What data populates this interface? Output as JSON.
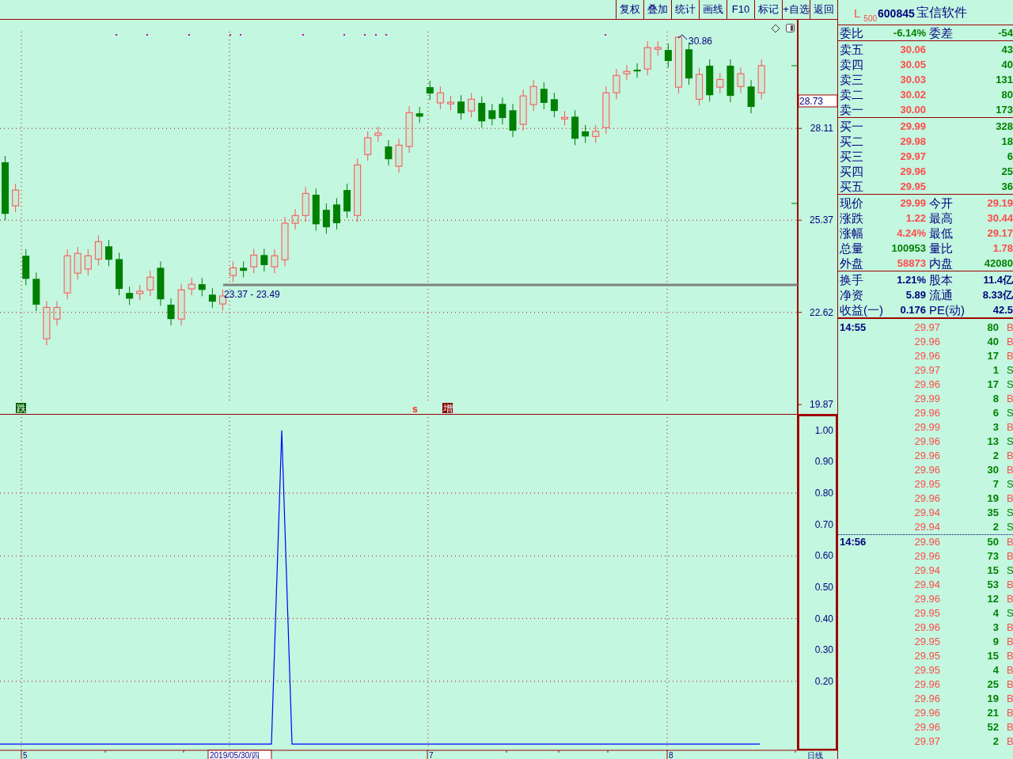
{
  "toolbar": [
    {
      "label": "复权"
    },
    {
      "label": "叠加"
    },
    {
      "label": "统计"
    },
    {
      "label": "画线"
    },
    {
      "label": "F10"
    },
    {
      "label": "标记"
    },
    {
      "label": "+自选"
    },
    {
      "label": "返回"
    }
  ],
  "quote_header": {
    "market": "L",
    "board": "500",
    "code": "600845",
    "name": "宝信软件"
  },
  "order_ratio": {
    "label": "委比",
    "value": "-6.14%",
    "label2": "委差",
    "value2": "-54"
  },
  "asks": [
    {
      "label": "卖五",
      "price": "30.06",
      "volume": "43"
    },
    {
      "label": "卖四",
      "price": "30.05",
      "volume": "40"
    },
    {
      "label": "卖三",
      "price": "30.03",
      "volume": "131"
    },
    {
      "label": "卖二",
      "price": "30.02",
      "volume": "80"
    },
    {
      "label": "卖一",
      "price": "30.00",
      "volume": "173"
    }
  ],
  "bids": [
    {
      "label": "买一",
      "price": "29.99",
      "volume": "328"
    },
    {
      "label": "买二",
      "price": "29.98",
      "volume": "18"
    },
    {
      "label": "买三",
      "price": "29.97",
      "volume": "6"
    },
    {
      "label": "买四",
      "price": "29.96",
      "volume": "25"
    },
    {
      "label": "买五",
      "price": "29.95",
      "volume": "36"
    }
  ],
  "stats": [
    {
      "left": {
        "label": "现价",
        "value": "29.99",
        "color": "#ff4a4a"
      },
      "right": {
        "label": "今开",
        "value": "29.19",
        "color": "#ff4a4a"
      }
    },
    {
      "left": {
        "label": "涨跌",
        "value": "1.22",
        "color": "#ff4a4a"
      },
      "right": {
        "label": "最高",
        "value": "30.44",
        "color": "#ff4a4a"
      }
    },
    {
      "left": {
        "label": "涨幅",
        "value": "4.24%",
        "color": "#ff4a4a"
      },
      "right": {
        "label": "最低",
        "value": "29.17",
        "color": "#ff4a4a"
      }
    },
    {
      "left": {
        "label": "总量",
        "value": "100953",
        "color": "#008000"
      },
      "right": {
        "label": "量比",
        "value": "1.78",
        "color": "#ff4a4a"
      }
    },
    {
      "left": {
        "label": "外盘",
        "value": "58873",
        "color": "#ff4a4a"
      },
      "right": {
        "label": "内盘",
        "value": "42080",
        "color": "#008000"
      }
    }
  ],
  "fundamentals": [
    {
      "label": "换手",
      "value": "1.21%",
      "label2": "股本",
      "value2": "11.4亿"
    },
    {
      "label": "净资",
      "value": "5.89",
      "label2": "流通",
      "value2": "8.33亿"
    },
    {
      "label": "收益(一)",
      "value": "0.176",
      "label2": "PE(动)",
      "value2": "42.5"
    }
  ],
  "trade_groups": [
    {
      "time": "14:55",
      "trades": [
        {
          "price": "29.97",
          "volume": "80",
          "side": "B",
          "kind": "buy"
        },
        {
          "price": "29.96",
          "volume": "40",
          "side": "B",
          "kind": "buy"
        },
        {
          "price": "29.96",
          "volume": "17",
          "side": "B",
          "kind": "buy"
        },
        {
          "price": "29.97",
          "volume": "1",
          "side": "S",
          "kind": "sell"
        },
        {
          "price": "29.96",
          "volume": "17",
          "side": "S",
          "kind": "sell"
        },
        {
          "price": "29.99",
          "volume": "8",
          "side": "B",
          "kind": "buy"
        },
        {
          "price": "29.96",
          "volume": "6",
          "side": "S",
          "kind": "sell"
        },
        {
          "price": "29.99",
          "volume": "3",
          "side": "B",
          "kind": "buy"
        },
        {
          "price": "29.96",
          "volume": "13",
          "side": "S",
          "kind": "sell"
        },
        {
          "price": "29.96",
          "volume": "2",
          "side": "B",
          "kind": "buy"
        },
        {
          "price": "29.96",
          "volume": "30",
          "side": "B",
          "kind": "buy"
        },
        {
          "price": "29.95",
          "volume": "7",
          "side": "S",
          "kind": "sell"
        },
        {
          "price": "29.96",
          "volume": "19",
          "side": "B",
          "kind": "buy"
        },
        {
          "price": "29.94",
          "volume": "35",
          "side": "S",
          "kind": "sell"
        },
        {
          "price": "29.94",
          "volume": "2",
          "side": "S",
          "kind": "sell"
        }
      ]
    },
    {
      "time": "14:56",
      "trades": [
        {
          "price": "29.96",
          "volume": "50",
          "side": "B",
          "kind": "buy"
        },
        {
          "price": "29.96",
          "volume": "73",
          "side": "B",
          "kind": "buy"
        },
        {
          "price": "29.94",
          "volume": "15",
          "side": "S",
          "kind": "sell"
        },
        {
          "price": "29.94",
          "volume": "53",
          "side": "B",
          "kind": "buy"
        },
        {
          "price": "29.96",
          "volume": "12",
          "side": "B",
          "kind": "buy"
        },
        {
          "price": "29.95",
          "volume": "4",
          "side": "S",
          "kind": "sell"
        },
        {
          "price": "29.96",
          "volume": "3",
          "side": "B",
          "kind": "buy"
        },
        {
          "price": "29.95",
          "volume": "9",
          "side": "B",
          "kind": "buy"
        },
        {
          "price": "29.95",
          "volume": "15",
          "side": "B",
          "kind": "buy"
        },
        {
          "price": "29.95",
          "volume": "4",
          "side": "B",
          "kind": "buy"
        },
        {
          "price": "29.96",
          "volume": "25",
          "side": "B",
          "kind": "buy"
        },
        {
          "price": "29.96",
          "volume": "19",
          "side": "B",
          "kind": "buy"
        },
        {
          "price": "29.96",
          "volume": "21",
          "side": "B",
          "kind": "buy"
        },
        {
          "price": "29.96",
          "volume": "52",
          "side": "B",
          "kind": "buy"
        },
        {
          "price": "29.97",
          "volume": "2",
          "side": "B",
          "kind": "buy"
        }
      ]
    }
  ],
  "price_axis": {
    "current_label": "28.73"
  },
  "price_chart": {
    "high_label": "30.86",
    "range_label": "23.37 - 23.49",
    "markers": [
      {
        "text": "跌",
        "kind": "badge_down"
      },
      {
        "text": "s",
        "kind": "letter"
      },
      {
        "text": "增",
        "kind": "badge_up"
      }
    ],
    "chart_data": {
      "type": "candlestick",
      "grid": true,
      "ylim": [
        19.59,
        31.35
      ],
      "yticks": [
        28.11,
        25.37,
        22.62,
        19.87
      ],
      "categories": [
        null,
        null,
        null,
        null,
        null,
        null,
        null,
        null,
        null,
        null,
        null,
        null,
        null,
        null,
        null,
        null,
        null,
        null,
        null,
        null,
        null,
        null,
        null,
        null,
        null,
        null,
        null,
        null,
        null,
        null,
        null,
        null,
        null,
        null,
        null,
        null,
        null,
        null,
        null,
        null,
        null,
        null,
        null,
        null,
        null,
        null,
        null,
        null,
        null,
        null,
        null,
        null,
        null,
        null,
        null,
        null,
        null,
        null,
        null,
        null,
        null,
        null,
        null,
        null,
        null,
        null,
        null,
        null,
        null,
        null,
        null,
        null,
        null,
        null,
        null,
        null,
        null
      ],
      "ohlc": [
        [
          27.1,
          27.29,
          25.37,
          25.56
        ],
        [
          25.8,
          26.46,
          25.61,
          26.27
        ],
        [
          24.31,
          24.5,
          23.43,
          23.62
        ],
        [
          23.62,
          23.81,
          22.66,
          22.85
        ],
        [
          21.83,
          22.96,
          21.64,
          22.77
        ],
        [
          22.42,
          22.96,
          22.23,
          22.77
        ],
        [
          23.2,
          24.5,
          23.01,
          24.31
        ],
        [
          23.79,
          24.57,
          23.6,
          24.38
        ],
        [
          23.91,
          24.5,
          23.72,
          24.31
        ],
        [
          24.21,
          24.92,
          24.02,
          24.73
        ],
        [
          24.59,
          24.78,
          24.0,
          24.19
        ],
        [
          24.21,
          24.4,
          23.13,
          23.32
        ],
        [
          23.2,
          23.39,
          22.84,
          23.03
        ],
        [
          23.18,
          23.44,
          22.99,
          23.25
        ],
        [
          23.29,
          23.86,
          23.1,
          23.67
        ],
        [
          23.95,
          24.14,
          22.82,
          23.01
        ],
        [
          22.85,
          23.04,
          22.23,
          22.42
        ],
        [
          22.42,
          23.48,
          22.23,
          23.29
        ],
        [
          23.32,
          23.65,
          23.13,
          23.46
        ],
        [
          23.46,
          23.65,
          23.1,
          23.29
        ],
        [
          23.15,
          23.34,
          22.75,
          22.94
        ],
        [
          22.87,
          23.3,
          22.68,
          23.11
        ],
        [
          23.72,
          24.14,
          23.53,
          23.95
        ],
        [
          23.95,
          24.14,
          23.67,
          23.86
        ],
        [
          23.98,
          24.52,
          23.79,
          24.33
        ],
        [
          24.33,
          24.52,
          23.84,
          24.03
        ],
        [
          23.98,
          24.5,
          23.79,
          24.31
        ],
        [
          24.19,
          25.47,
          24.0,
          25.28
        ],
        [
          25.28,
          25.7,
          25.09,
          25.51
        ],
        [
          25.51,
          26.36,
          25.32,
          26.17
        ],
        [
          26.13,
          26.32,
          25.06,
          25.25
        ],
        [
          25.68,
          25.87,
          24.97,
          25.16
        ],
        [
          25.84,
          26.03,
          25.09,
          25.28
        ],
        [
          26.27,
          26.46,
          25.44,
          25.63
        ],
        [
          25.51,
          27.21,
          25.32,
          27.02
        ],
        [
          27.33,
          28.02,
          27.14,
          27.83
        ],
        [
          27.9,
          28.16,
          27.71,
          27.97
        ],
        [
          27.57,
          27.76,
          27.0,
          27.19
        ],
        [
          26.98,
          27.8,
          26.79,
          27.61
        ],
        [
          27.57,
          28.77,
          27.38,
          28.58
        ],
        [
          28.56,
          28.75,
          28.27,
          28.46
        ],
        [
          29.34,
          29.53,
          28.96,
          29.15
        ],
        [
          28.87,
          29.36,
          28.68,
          29.17
        ],
        [
          28.84,
          29.08,
          28.65,
          28.89
        ],
        [
          28.91,
          29.1,
          28.37,
          28.56
        ],
        [
          28.63,
          29.17,
          28.44,
          28.98
        ],
        [
          28.87,
          29.06,
          28.13,
          28.32
        ],
        [
          28.65,
          28.84,
          28.2,
          28.39
        ],
        [
          28.84,
          29.03,
          28.23,
          28.42
        ],
        [
          28.65,
          28.84,
          27.85,
          28.04
        ],
        [
          28.23,
          29.27,
          28.04,
          29.08
        ],
        [
          28.82,
          29.55,
          28.63,
          29.36
        ],
        [
          29.29,
          29.48,
          28.68,
          28.87
        ],
        [
          28.98,
          29.17,
          28.44,
          28.63
        ],
        [
          28.39,
          28.63,
          28.2,
          28.44
        ],
        [
          28.46,
          28.65,
          27.61,
          27.8
        ],
        [
          28.02,
          28.21,
          27.68,
          27.87
        ],
        [
          27.87,
          28.21,
          27.68,
          28.02
        ],
        [
          28.13,
          29.36,
          27.94,
          29.17
        ],
        [
          29.17,
          29.88,
          28.98,
          29.69
        ],
        [
          29.74,
          30.0,
          29.55,
          29.81
        ],
        [
          29.86,
          30.05,
          29.62,
          29.81
        ],
        [
          29.88,
          30.71,
          29.69,
          30.52
        ],
        [
          30.47,
          30.71,
          30.28,
          30.52
        ],
        [
          30.45,
          30.64,
          29.93,
          30.12
        ],
        [
          29.34,
          30.86,
          29.15,
          30.83
        ],
        [
          30.47,
          30.66,
          29.41,
          29.6
        ],
        [
          28.98,
          29.91,
          28.79,
          29.72
        ],
        [
          29.98,
          30.17,
          28.91,
          29.1
        ],
        [
          29.34,
          29.76,
          29.15,
          29.57
        ],
        [
          29.98,
          30.17,
          28.89,
          29.08
        ],
        [
          29.36,
          29.93,
          29.17,
          29.74
        ],
        [
          29.36,
          29.55,
          28.56,
          28.75
        ],
        [
          29.17,
          30.17,
          28.98,
          29.98
        ],
        null,
        null,
        null
      ]
    }
  },
  "indicator_chart": {
    "chart_data": {
      "type": "line",
      "grid": true,
      "ylim": [
        -0.02,
        1.05
      ],
      "yticks": [
        {
          "value": 1,
          "label": "1.00"
        },
        {
          "value": 0.9,
          "label": "0.90"
        },
        {
          "value": 0.8,
          "label": "0.80"
        },
        {
          "value": 0.7,
          "label": "0.70"
        },
        {
          "value": 0.6,
          "label": "0.60"
        },
        {
          "value": 0.5,
          "label": "0.50"
        },
        {
          "value": 0.4,
          "label": "0.40"
        },
        {
          "value": 0.3,
          "label": "0.30"
        },
        {
          "value": 0.2,
          "label": "0.20"
        }
      ],
      "series": [
        {
          "color": "#0000ff",
          "values": [
            0,
            0,
            0,
            0,
            0,
            0,
            0,
            0,
            0,
            0,
            0,
            0,
            0,
            0,
            0,
            0,
            0,
            0,
            0,
            0,
            0,
            0,
            0,
            0,
            0,
            0,
            0,
            1,
            0,
            0,
            0,
            0,
            0,
            0,
            0,
            0,
            0,
            0,
            0,
            0,
            0,
            0,
            0,
            0,
            0,
            0,
            0,
            0,
            0,
            0,
            0,
            0,
            0,
            0,
            0,
            0,
            0,
            0,
            0,
            0,
            0,
            0,
            0,
            0,
            0,
            0,
            0,
            0,
            0,
            0,
            0,
            0,
            0,
            0
          ]
        }
      ]
    }
  },
  "date_axis": [
    {
      "label": "5",
      "selected": false
    },
    {
      "label": "2019/05/30/四",
      "selected": true
    },
    {
      "label": "7",
      "selected": false
    },
    {
      "label": "8",
      "selected": false
    }
  ],
  "period": "日线"
}
